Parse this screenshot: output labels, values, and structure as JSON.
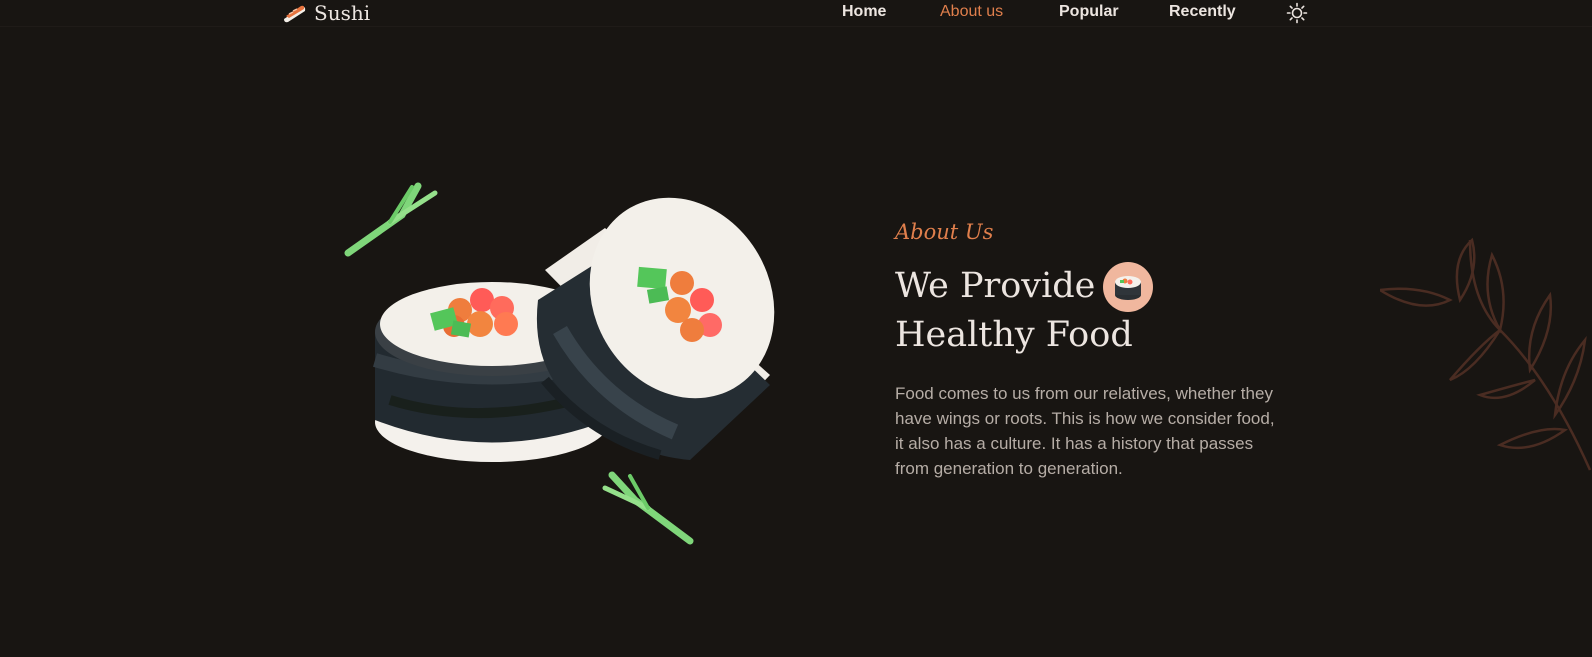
{
  "header": {
    "logo_text": "Sushi",
    "logo_icon": "sushi-nigiri-icon",
    "nav": [
      {
        "label": "Home",
        "active": false
      },
      {
        "label": "About us",
        "active": true
      },
      {
        "label": "Popular",
        "active": false
      },
      {
        "label": "Recently",
        "active": false
      }
    ],
    "theme_icon": "sun-icon"
  },
  "about": {
    "subtitle": "About Us",
    "title_line1": "We Provide",
    "title_line2": "Healthy Food",
    "badge_icon": "sushi-roll-icon",
    "description": "Food comes to us from our relatives, whether they have wings or roots. This is how we consider food, it also has a culture. It has a history that passes from generation to generation."
  },
  "colors": {
    "background": "#181512",
    "accent": "#e07f4c",
    "text": "#ece5e0",
    "muted_text": "#b6ada6",
    "badge": "#f0b79e"
  }
}
